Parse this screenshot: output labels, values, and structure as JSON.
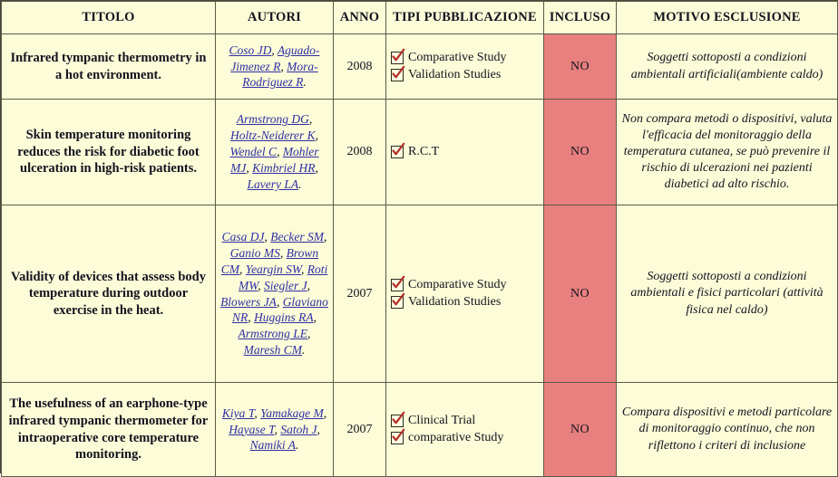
{
  "table": {
    "headers": [
      {
        "key": "titolo",
        "label": "TITOLO"
      },
      {
        "key": "autori",
        "label": "AUTORI"
      },
      {
        "key": "anno",
        "label": "ANNO"
      },
      {
        "key": "tipi",
        "label": "TIPI PUBBLICAZIONE"
      },
      {
        "key": "incluso",
        "label": "INCLUSO"
      },
      {
        "key": "motivo",
        "label": "MOTIVO ESCLUSIONE"
      }
    ],
    "rows": [
      {
        "title": "Infrared tympanic thermometry in a hot environment.",
        "authors": "Coso JD, Aguado-Jimenez R, Mora-Rodriguez R.",
        "year": "2008",
        "types": [
          "Comparative Study",
          "Validation Studies"
        ],
        "included": "NO",
        "reason": "Soggetti sottoposti a condizioni ambientali artificiali(ambiente caldo)"
      },
      {
        "title": "Skin temperature monitoring reduces the risk for diabetic foot ulceration in high-risk patients.",
        "authors": "Armstrong DG, Holtz-Neiderer K, Wendel C, Mohler MJ, Kimbriel HR, Lavery LA.",
        "year": "2008",
        "types": [
          "R.C.T"
        ],
        "included": "NO",
        "reason": "Non compara metodi o dispositivi, valuta l'efficacia del monitoraggio della temperatura cutanea, se può prevenire il rischio di ulcerazioni nei pazienti diabetici ad alto rischio."
      },
      {
        "title": "Validity of devices that assess body temperature during outdoor exercise in the heat.",
        "authors": "Casa DJ, Becker SM, Ganio MS, Brown CM, Yeargin SW, Roti MW, Siegler J, Blowers JA, Glaviano NR, Huggins RA, Armstrong LE, Maresh CM.",
        "year": "2007",
        "types": [
          "Comparative Study",
          "Validation Studies"
        ],
        "included": "NO",
        "reason": "Soggetti sottoposti a condizioni ambientali e fisici particolari (attività fisica nel caldo)"
      },
      {
        "title": "The usefulness of an earphone-type infrared tympanic thermometer for intraoperative core temperature monitoring.",
        "authors": "Kiya T, Yamakage M, Hayase T, Satoh J, Namiki A.",
        "year": "2007",
        "types": [
          "Clinical Trial",
          "comparative Study"
        ],
        "included": "NO",
        "reason": "Compara dispositivi e metodi particolare di monitoraggio continuo, che non riflettono i criteri di inclusione"
      }
    ]
  },
  "colors": {
    "header_background": "#7dfcef",
    "cell_background": "#fcfcd8",
    "excluded_background": "#e8807f",
    "author_text": "#2f2fa6",
    "border": "#5b5b46"
  }
}
